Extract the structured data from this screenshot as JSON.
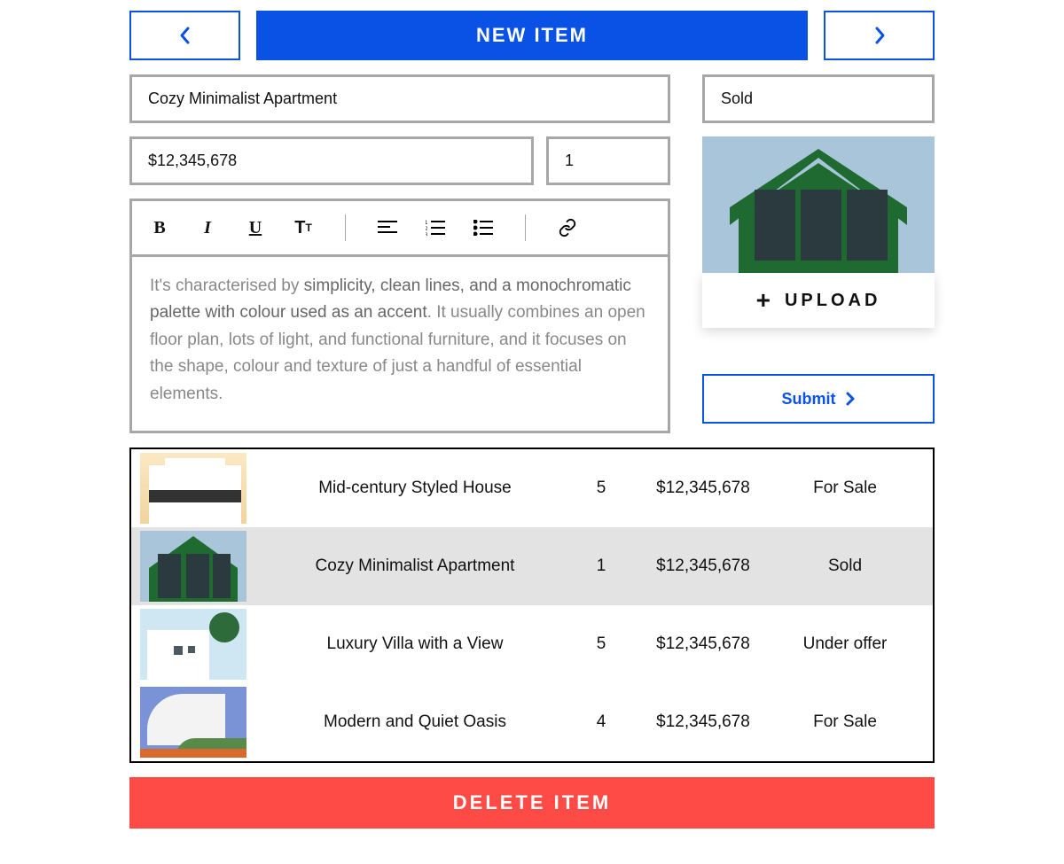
{
  "topbar": {
    "new_item_label": "NEW ITEM"
  },
  "form": {
    "title": "Cozy Minimalist Apartment",
    "status": "Sold",
    "price": "$12,345,678",
    "quantity": "1",
    "description_prefix": "It's characterised by ",
    "description_em": "simplicity, clean lines, and a monochromatic palette with colour used as an accent",
    "description_suffix": ". It usually combines an open floor plan, lots of light, and functional furniture, and it focuses on the shape, colour and texture of just a handful of essential elements.",
    "toolbar": {
      "bold": "B",
      "italic": "I",
      "underline": "U"
    }
  },
  "upload": {
    "label": "UPLOAD"
  },
  "submit": {
    "label": "Submit"
  },
  "delete": {
    "label": "DELETE ITEM"
  },
  "listings": [
    {
      "name": "Mid-century Styled House",
      "qty": "5",
      "price": "$12,345,678",
      "status": "For Sale",
      "selected": false
    },
    {
      "name": "Cozy Minimalist Apartment",
      "qty": "1",
      "price": "$12,345,678",
      "status": "Sold",
      "selected": true
    },
    {
      "name": "Luxury Villa with a View",
      "qty": "5",
      "price": "$12,345,678",
      "status": "Under offer",
      "selected": false
    },
    {
      "name": "Modern and Quiet Oasis",
      "qty": "4",
      "price": "$12,345,678",
      "status": "For Sale",
      "selected": false
    }
  ],
  "colors": {
    "primary": "#0a52e6",
    "danger": "#ff4b46",
    "border": "#a7a7a7"
  }
}
